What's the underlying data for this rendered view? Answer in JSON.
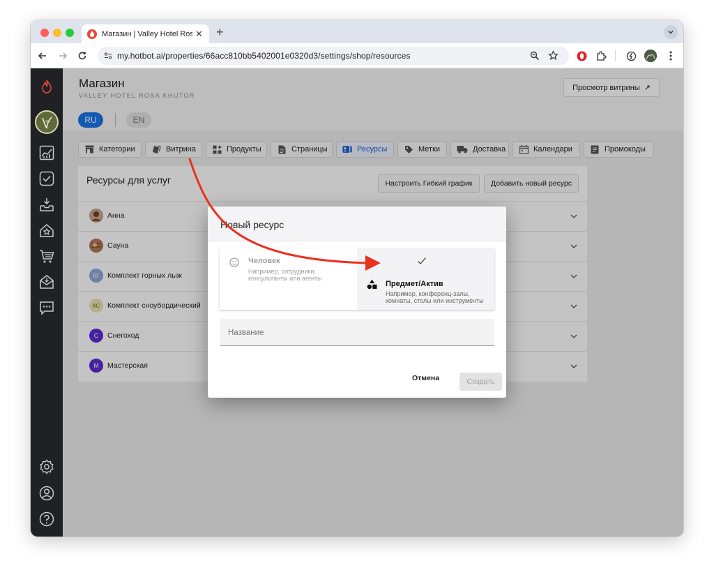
{
  "browser": {
    "tab_title": "Магазин | Valley Hotel Rosa K",
    "url": "my.hotbot.ai/properties/66acc810bb5402001e0320d3/settings/shop/resources",
    "new_tab_label": "+",
    "tab_close_label": "✕"
  },
  "header": {
    "title": "Магазин",
    "subtitle": "VALLEY HOTEL ROSA KHUTOR",
    "preview_button": "Просмотр витрины",
    "preview_arrow": "↗"
  },
  "languages": [
    {
      "code": "RU",
      "active": true
    },
    {
      "code": "EN",
      "active": false
    }
  ],
  "shop_tabs": [
    {
      "label": "Категории",
      "icon": "store-icon"
    },
    {
      "label": "Витрина",
      "icon": "tag-cards-icon"
    },
    {
      "label": "Продукты",
      "icon": "grid-plus-icon"
    },
    {
      "label": "Страницы",
      "icon": "page-icon"
    },
    {
      "label": "Ресурсы",
      "icon": "resource-card-icon",
      "active": true
    },
    {
      "label": "Метки",
      "icon": "label-icon"
    },
    {
      "label": "Доставка",
      "icon": "truck-icon"
    },
    {
      "label": "Календари",
      "icon": "calendar-icon"
    },
    {
      "label": "Промокоды",
      "icon": "promo-icon"
    }
  ],
  "resources_card": {
    "title": "Ресурсы для услуг",
    "flexible_schedule_button": "Настроить Гибкий график",
    "add_resource_button": "Добавить новый ресурс",
    "items": [
      {
        "name": "Анна",
        "avatar": "",
        "avatar_color": "#8a5a44",
        "photo": true
      },
      {
        "name": "Сауна",
        "avatar": "",
        "avatar_color": "#b07050",
        "photo": true
      },
      {
        "name": "Комплект горных лыж",
        "avatar": "КГ",
        "avatar_color": "#8fa7d9"
      },
      {
        "name": "Комплект сноубордический",
        "avatar": "КС",
        "avatar_color": "#e8e6b0"
      },
      {
        "name": "Снегоход",
        "avatar": "С",
        "avatar_color": "#5b2bd0"
      },
      {
        "name": "Мастерская",
        "avatar": "М",
        "avatar_color": "#5b2bd0"
      }
    ]
  },
  "dialog": {
    "title": "Новый ресурс",
    "option_person": {
      "label": "Человек",
      "description_line1": "Например, сотрудники,",
      "description_line2": "консультанты или агенты"
    },
    "option_asset": {
      "label": "Предмет/Актив",
      "description_line1": "Например, конференц-залы,",
      "description_line2": "комнаты, столы или инструменты",
      "selected": true
    },
    "name_placeholder": "Название",
    "cancel_button": "Отмена",
    "create_button": "Создать"
  },
  "colors": {
    "accent": "#1a73e8",
    "annotation_arrow": "#e8321f",
    "sidebar": "#202124",
    "brand_red": "#e94b3c"
  }
}
